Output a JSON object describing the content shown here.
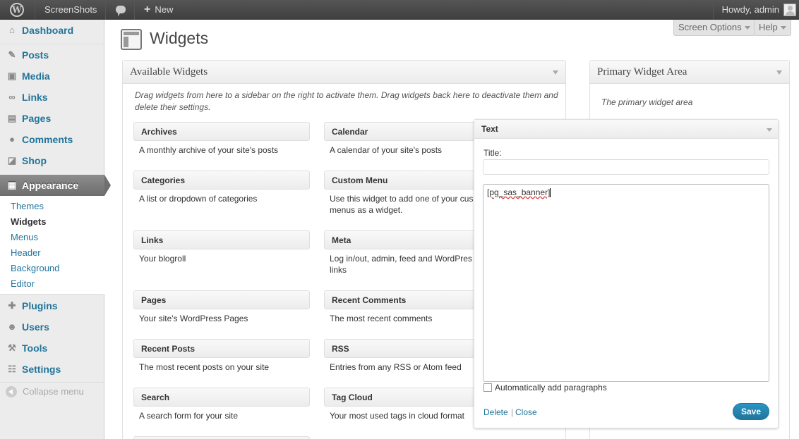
{
  "admin_bar": {
    "site_name": "ScreenShots",
    "new_label": "New",
    "howdy": "Howdy, admin"
  },
  "menu": {
    "items": [
      {
        "label": "Dashboard",
        "icon": "dashboard-icon"
      },
      {
        "label": "Posts",
        "icon": "pin-icon"
      },
      {
        "label": "Media",
        "icon": "media-icon"
      },
      {
        "label": "Links",
        "icon": "link-icon"
      },
      {
        "label": "Pages",
        "icon": "pages-icon"
      },
      {
        "label": "Comments",
        "icon": "comment-icon"
      },
      {
        "label": "Shop",
        "icon": "shop-icon"
      },
      {
        "label": "Appearance",
        "icon": "appearance-icon"
      },
      {
        "label": "Plugins",
        "icon": "plugin-icon"
      },
      {
        "label": "Users",
        "icon": "users-icon"
      },
      {
        "label": "Tools",
        "icon": "tools-icon"
      },
      {
        "label": "Settings",
        "icon": "settings-icon"
      }
    ],
    "submenu": [
      "Themes",
      "Widgets",
      "Menus",
      "Header",
      "Background",
      "Editor"
    ],
    "collapse": "Collapse menu"
  },
  "screen_options": "Screen Options",
  "help": "Help",
  "page_title": "Widgets",
  "available": {
    "title": "Available Widgets",
    "description": "Drag widgets from here to a sidebar on the right to activate them. Drag widgets back here to deactivate them and delete their settings.",
    "widgets": [
      {
        "name": "Archives",
        "desc": "A monthly archive of your site's posts"
      },
      {
        "name": "Calendar",
        "desc": "A calendar of your site's posts"
      },
      {
        "name": "Categories",
        "desc": "A list or dropdown of categories"
      },
      {
        "name": "Custom Menu",
        "desc": "Use this widget to add one of your cus menus as a widget."
      },
      {
        "name": "Links",
        "desc": "Your blogroll"
      },
      {
        "name": "Meta",
        "desc": "Log in/out, admin, feed and WordPres links"
      },
      {
        "name": "Pages",
        "desc": "Your site's WordPress Pages"
      },
      {
        "name": "Recent Comments",
        "desc": "The most recent comments"
      },
      {
        "name": "Recent Posts",
        "desc": "The most recent posts on your site"
      },
      {
        "name": "RSS",
        "desc": "Entries from any RSS or Atom feed"
      },
      {
        "name": "Search",
        "desc": "A search form for your site"
      },
      {
        "name": "Tag Cloud",
        "desc": "Your most used tags in cloud format"
      }
    ]
  },
  "primary": {
    "title": "Primary Widget Area",
    "description": "The primary widget area"
  },
  "text_widget": {
    "title": "Text",
    "title_label": "Title:",
    "title_value": "",
    "content": "[pg_sas_banner]",
    "auto_paragraphs": "Automatically add paragraphs",
    "auto_paragraphs_checked": false,
    "delete": "Delete",
    "separator": "|",
    "close": "Close",
    "save": "Save"
  }
}
